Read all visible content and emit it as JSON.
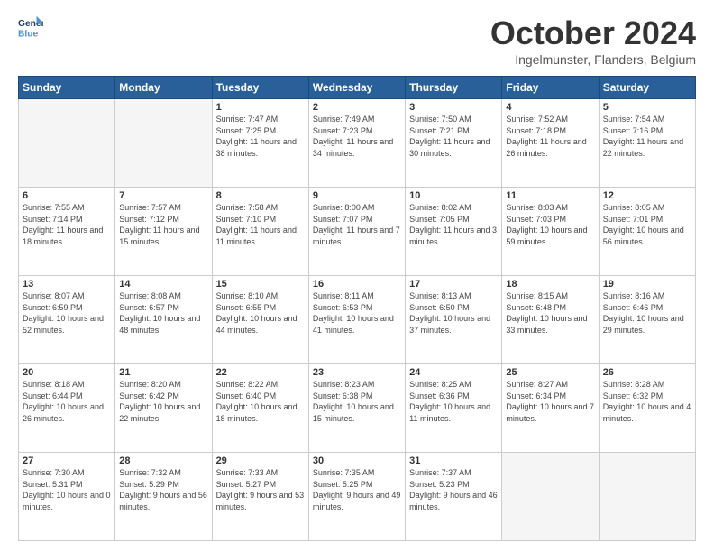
{
  "header": {
    "logo_line1": "General",
    "logo_line2": "Blue",
    "month": "October 2024",
    "location": "Ingelmunster, Flanders, Belgium"
  },
  "days_of_week": [
    "Sunday",
    "Monday",
    "Tuesday",
    "Wednesday",
    "Thursday",
    "Friday",
    "Saturday"
  ],
  "weeks": [
    [
      {
        "day": "",
        "info": ""
      },
      {
        "day": "",
        "info": ""
      },
      {
        "day": "1",
        "info": "Sunrise: 7:47 AM\nSunset: 7:25 PM\nDaylight: 11 hours\nand 38 minutes."
      },
      {
        "day": "2",
        "info": "Sunrise: 7:49 AM\nSunset: 7:23 PM\nDaylight: 11 hours\nand 34 minutes."
      },
      {
        "day": "3",
        "info": "Sunrise: 7:50 AM\nSunset: 7:21 PM\nDaylight: 11 hours\nand 30 minutes."
      },
      {
        "day": "4",
        "info": "Sunrise: 7:52 AM\nSunset: 7:18 PM\nDaylight: 11 hours\nand 26 minutes."
      },
      {
        "day": "5",
        "info": "Sunrise: 7:54 AM\nSunset: 7:16 PM\nDaylight: 11 hours\nand 22 minutes."
      }
    ],
    [
      {
        "day": "6",
        "info": "Sunrise: 7:55 AM\nSunset: 7:14 PM\nDaylight: 11 hours\nand 18 minutes."
      },
      {
        "day": "7",
        "info": "Sunrise: 7:57 AM\nSunset: 7:12 PM\nDaylight: 11 hours\nand 15 minutes."
      },
      {
        "day": "8",
        "info": "Sunrise: 7:58 AM\nSunset: 7:10 PM\nDaylight: 11 hours\nand 11 minutes."
      },
      {
        "day": "9",
        "info": "Sunrise: 8:00 AM\nSunset: 7:07 PM\nDaylight: 11 hours\nand 7 minutes."
      },
      {
        "day": "10",
        "info": "Sunrise: 8:02 AM\nSunset: 7:05 PM\nDaylight: 11 hours\nand 3 minutes."
      },
      {
        "day": "11",
        "info": "Sunrise: 8:03 AM\nSunset: 7:03 PM\nDaylight: 10 hours\nand 59 minutes."
      },
      {
        "day": "12",
        "info": "Sunrise: 8:05 AM\nSunset: 7:01 PM\nDaylight: 10 hours\nand 56 minutes."
      }
    ],
    [
      {
        "day": "13",
        "info": "Sunrise: 8:07 AM\nSunset: 6:59 PM\nDaylight: 10 hours\nand 52 minutes."
      },
      {
        "day": "14",
        "info": "Sunrise: 8:08 AM\nSunset: 6:57 PM\nDaylight: 10 hours\nand 48 minutes."
      },
      {
        "day": "15",
        "info": "Sunrise: 8:10 AM\nSunset: 6:55 PM\nDaylight: 10 hours\nand 44 minutes."
      },
      {
        "day": "16",
        "info": "Sunrise: 8:11 AM\nSunset: 6:53 PM\nDaylight: 10 hours\nand 41 minutes."
      },
      {
        "day": "17",
        "info": "Sunrise: 8:13 AM\nSunset: 6:50 PM\nDaylight: 10 hours\nand 37 minutes."
      },
      {
        "day": "18",
        "info": "Sunrise: 8:15 AM\nSunset: 6:48 PM\nDaylight: 10 hours\nand 33 minutes."
      },
      {
        "day": "19",
        "info": "Sunrise: 8:16 AM\nSunset: 6:46 PM\nDaylight: 10 hours\nand 29 minutes."
      }
    ],
    [
      {
        "day": "20",
        "info": "Sunrise: 8:18 AM\nSunset: 6:44 PM\nDaylight: 10 hours\nand 26 minutes."
      },
      {
        "day": "21",
        "info": "Sunrise: 8:20 AM\nSunset: 6:42 PM\nDaylight: 10 hours\nand 22 minutes."
      },
      {
        "day": "22",
        "info": "Sunrise: 8:22 AM\nSunset: 6:40 PM\nDaylight: 10 hours\nand 18 minutes."
      },
      {
        "day": "23",
        "info": "Sunrise: 8:23 AM\nSunset: 6:38 PM\nDaylight: 10 hours\nand 15 minutes."
      },
      {
        "day": "24",
        "info": "Sunrise: 8:25 AM\nSunset: 6:36 PM\nDaylight: 10 hours\nand 11 minutes."
      },
      {
        "day": "25",
        "info": "Sunrise: 8:27 AM\nSunset: 6:34 PM\nDaylight: 10 hours\nand 7 minutes."
      },
      {
        "day": "26",
        "info": "Sunrise: 8:28 AM\nSunset: 6:32 PM\nDaylight: 10 hours\nand 4 minutes."
      }
    ],
    [
      {
        "day": "27",
        "info": "Sunrise: 7:30 AM\nSunset: 5:31 PM\nDaylight: 10 hours\nand 0 minutes."
      },
      {
        "day": "28",
        "info": "Sunrise: 7:32 AM\nSunset: 5:29 PM\nDaylight: 9 hours\nand 56 minutes."
      },
      {
        "day": "29",
        "info": "Sunrise: 7:33 AM\nSunset: 5:27 PM\nDaylight: 9 hours\nand 53 minutes."
      },
      {
        "day": "30",
        "info": "Sunrise: 7:35 AM\nSunset: 5:25 PM\nDaylight: 9 hours\nand 49 minutes."
      },
      {
        "day": "31",
        "info": "Sunrise: 7:37 AM\nSunset: 5:23 PM\nDaylight: 9 hours\nand 46 minutes."
      },
      {
        "day": "",
        "info": ""
      },
      {
        "day": "",
        "info": ""
      }
    ]
  ]
}
